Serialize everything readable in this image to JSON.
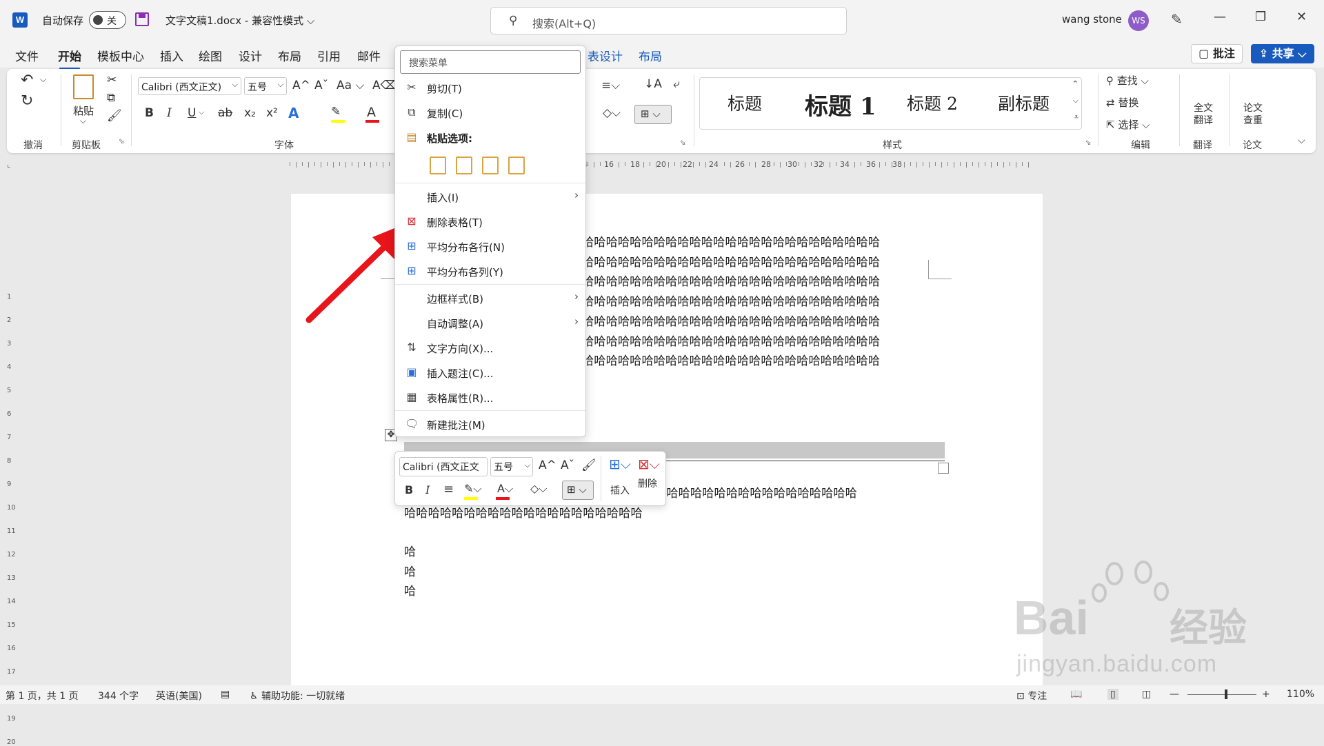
{
  "titlebar": {
    "logo": "W",
    "autosave_label": "自动保存",
    "autosave_state": "关",
    "doc_title": "文字文稿1.docx  -  兼容性模式",
    "search_placeholder": "搜索(Alt+Q)",
    "user_name": "wang stone",
    "user_initials": "WS",
    "minimize": "—",
    "restore": "❐",
    "close": "✕"
  },
  "tabs": [
    "文件",
    "开始",
    "模板中心",
    "插入",
    "绘图",
    "设计",
    "布局",
    "引用",
    "邮件"
  ],
  "context_tabs": [
    "表设计",
    "布局"
  ],
  "buttons": {
    "comment": "批注",
    "share": "共享"
  },
  "ribbon": {
    "font_name": "Calibri (西文正文)",
    "font_size": "五号",
    "paste_label": "粘贴",
    "groups": {
      "undo": "撤消",
      "clipboard": "剪贴板",
      "font": "字体",
      "styles": "样式",
      "editing": "编辑",
      "translate": "翻译",
      "paper": "论文"
    },
    "styles": [
      "标题",
      "标题 1",
      "标题 2",
      "副标题"
    ],
    "editing": {
      "find": "查找",
      "replace": "替换",
      "select": "选择"
    },
    "translate_btn": "全文翻译",
    "paper_btn": "论文查重",
    "format": {
      "bold": "B",
      "italic": "I",
      "underline": "U",
      "strike": "ab",
      "sub": "x₂",
      "sup": "x²",
      "case": "Aa",
      "grow": "A^",
      "shrink": "Aˇ"
    }
  },
  "ruler_numbers": [
    "14",
    "16",
    "18",
    "20",
    "22",
    "24",
    "26",
    "28",
    "30",
    "32",
    "34",
    "36",
    "38"
  ],
  "vruler_numbers": [
    "1",
    "2",
    "3",
    "4",
    "5",
    "6",
    "7",
    "8",
    "9",
    "10",
    "11",
    "12",
    "13",
    "14",
    "15",
    "16",
    "17",
    "18",
    "19",
    "20"
  ],
  "document": {
    "row_text": "哈哈哈哈哈哈哈哈哈哈哈哈哈哈哈哈哈哈哈哈哈哈哈哈哈",
    "line_after_table_1": "哈哈哈哈哈哈哈哈哈哈哈哈哈哈哈哈哈哈哈哈哈哈哈哈哈哈哈哈哈哈哈哈哈哈哈哈哈哈",
    "line_after_table_2": "哈哈哈哈哈哈哈哈哈哈哈哈哈哈哈哈哈哈哈哈",
    "single_lines": [
      "哈",
      "哈",
      "哈"
    ]
  },
  "context_menu": {
    "search_placeholder": "搜索菜单",
    "items": [
      {
        "label": "剪切(T)",
        "icon": "cut-icon"
      },
      {
        "label": "复制(C)",
        "icon": "copy-icon"
      },
      {
        "label": "粘贴选项:",
        "icon": "paste-icon"
      },
      {
        "label": "插入(I)",
        "icon": ""
      },
      {
        "label": "删除表格(T)",
        "icon": "delete-table-icon"
      },
      {
        "label": "平均分布各行(N)",
        "icon": "distribute-rows-icon"
      },
      {
        "label": "平均分布各列(Y)",
        "icon": "distribute-columns-icon"
      },
      {
        "label": "边框样式(B)",
        "icon": ""
      },
      {
        "label": "自动调整(A)",
        "icon": ""
      },
      {
        "label": "文字方向(X)...",
        "icon": "text-direction-icon"
      },
      {
        "label": "插入题注(C)...",
        "icon": "insert-caption-icon"
      },
      {
        "label": "表格属性(R)...",
        "icon": "table-properties-icon"
      },
      {
        "label": "新建批注(M)",
        "icon": "new-comment-icon"
      }
    ]
  },
  "mini_toolbar": {
    "font_name": "Calibri (西文正文",
    "font_size": "五号",
    "insert_label": "插入",
    "delete_label": "删除"
  },
  "statusbar": {
    "page": "第 1 页，共 1 页",
    "words": "344 个字",
    "language": "英语(美国)",
    "accessibility": "辅助功能: 一切就绪",
    "focus": "专注",
    "zoom": "110%"
  },
  "watermark": {
    "brand": "Bai",
    "brand2": "经验",
    "url": "jingyan.baidu.com"
  },
  "colors": {
    "accent": "#185abd",
    "arrow": "#e8151b",
    "highlight": "#ffff00",
    "font_color": "#e8151b"
  }
}
